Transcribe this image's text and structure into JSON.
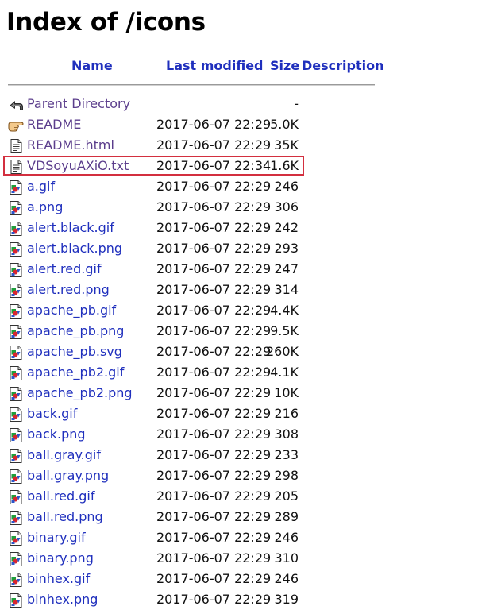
{
  "page": {
    "title": "Index of /icons"
  },
  "columns": {
    "name": "Name",
    "last_modified": "Last modified",
    "size": "Size",
    "description": "Description"
  },
  "highlight_color": "#d32f3f",
  "link_color": "#1f2fbd",
  "entries": [
    {
      "name": "Parent Directory",
      "date": "",
      "size": "-",
      "icon": "back-icon",
      "visited": true
    },
    {
      "name": "README",
      "date": "2017-06-07 22:29",
      "size": "5.0K",
      "icon": "hand-icon",
      "visited": true
    },
    {
      "name": "README.html",
      "date": "2017-06-07 22:29",
      "size": "35K",
      "icon": "text-file-icon",
      "visited": true
    },
    {
      "name": "VDSoyuAXiO.txt",
      "date": "2017-06-07 22:34",
      "size": "1.6K",
      "icon": "text-file-icon",
      "visited": true,
      "highlighted": true
    },
    {
      "name": "a.gif",
      "date": "2017-06-07 22:29",
      "size": "246",
      "icon": "image-file-icon"
    },
    {
      "name": "a.png",
      "date": "2017-06-07 22:29",
      "size": "306",
      "icon": "image-file-icon"
    },
    {
      "name": "alert.black.gif",
      "date": "2017-06-07 22:29",
      "size": "242",
      "icon": "image-file-icon"
    },
    {
      "name": "alert.black.png",
      "date": "2017-06-07 22:29",
      "size": "293",
      "icon": "image-file-icon"
    },
    {
      "name": "alert.red.gif",
      "date": "2017-06-07 22:29",
      "size": "247",
      "icon": "image-file-icon"
    },
    {
      "name": "alert.red.png",
      "date": "2017-06-07 22:29",
      "size": "314",
      "icon": "image-file-icon"
    },
    {
      "name": "apache_pb.gif",
      "date": "2017-06-07 22:29",
      "size": "4.4K",
      "icon": "image-file-icon"
    },
    {
      "name": "apache_pb.png",
      "date": "2017-06-07 22:29",
      "size": "9.5K",
      "icon": "image-file-icon"
    },
    {
      "name": "apache_pb.svg",
      "date": "2017-06-07 22:29",
      "size": "260K",
      "icon": "image-file-icon"
    },
    {
      "name": "apache_pb2.gif",
      "date": "2017-06-07 22:29",
      "size": "4.1K",
      "icon": "image-file-icon"
    },
    {
      "name": "apache_pb2.png",
      "date": "2017-06-07 22:29",
      "size": "10K",
      "icon": "image-file-icon"
    },
    {
      "name": "back.gif",
      "date": "2017-06-07 22:29",
      "size": "216",
      "icon": "image-file-icon"
    },
    {
      "name": "back.png",
      "date": "2017-06-07 22:29",
      "size": "308",
      "icon": "image-file-icon"
    },
    {
      "name": "ball.gray.gif",
      "date": "2017-06-07 22:29",
      "size": "233",
      "icon": "image-file-icon"
    },
    {
      "name": "ball.gray.png",
      "date": "2017-06-07 22:29",
      "size": "298",
      "icon": "image-file-icon"
    },
    {
      "name": "ball.red.gif",
      "date": "2017-06-07 22:29",
      "size": "205",
      "icon": "image-file-icon"
    },
    {
      "name": "ball.red.png",
      "date": "2017-06-07 22:29",
      "size": "289",
      "icon": "image-file-icon"
    },
    {
      "name": "binary.gif",
      "date": "2017-06-07 22:29",
      "size": "246",
      "icon": "image-file-icon"
    },
    {
      "name": "binary.png",
      "date": "2017-06-07 22:29",
      "size": "310",
      "icon": "image-file-icon"
    },
    {
      "name": "binhex.gif",
      "date": "2017-06-07 22:29",
      "size": "246",
      "icon": "image-file-icon"
    },
    {
      "name": "binhex.png",
      "date": "2017-06-07 22:29",
      "size": "319",
      "icon": "image-file-icon"
    }
  ]
}
